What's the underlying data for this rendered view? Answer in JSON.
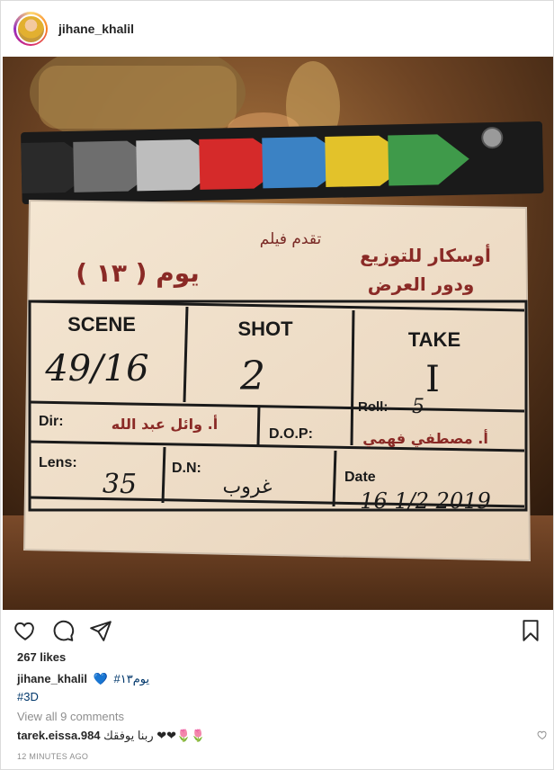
{
  "header": {
    "username": "jihane_khalil"
  },
  "photo": {
    "clapper_rows": {
      "presents": "تقدم فيلم",
      "title": "يوم ( ١٣ )",
      "distributor_line1": "أوسكار للتوزيع",
      "distributor_line2": "ودور العرض",
      "scene_label": "SCENE",
      "scene_value": "49/16",
      "shot_label": "SHOT",
      "shot_value": "2",
      "take_label": "TAKE",
      "take_value": "I",
      "roll_label": "Roll:",
      "roll_value": "5",
      "dir_label": "Dir:",
      "dir_value": "أ. وائل عبد الله",
      "dop_label": "D.O.P:",
      "dop_value": "أ. مصطفي فهمي",
      "lens_label": "Lens:",
      "lens_value": "35",
      "dn_label": "D.N:",
      "dn_value": "غروب",
      "date_label": "Date",
      "date_value": "16 1/2 2019"
    }
  },
  "actions": {
    "like": "heart-outline-icon",
    "comment": "comment-bubble-icon",
    "share": "paper-plane-icon",
    "save": "bookmark-icon"
  },
  "likes_text": "267 likes",
  "caption": {
    "username": "jihane_khalil",
    "heart": "💙",
    "text": "#يوم١٣",
    "tag": "#3D"
  },
  "view_all_text": "View all 9 comments",
  "comment": {
    "username": "tarek.eissa.984",
    "text": "ربنا يوفقك ❤❤🌷🌷"
  },
  "timestamp": "12 MINUTES AGO",
  "colors": {
    "link": "#00376b",
    "muted": "#8e8e8e",
    "text": "#262626",
    "heart_blue": "#1e6bd6"
  }
}
